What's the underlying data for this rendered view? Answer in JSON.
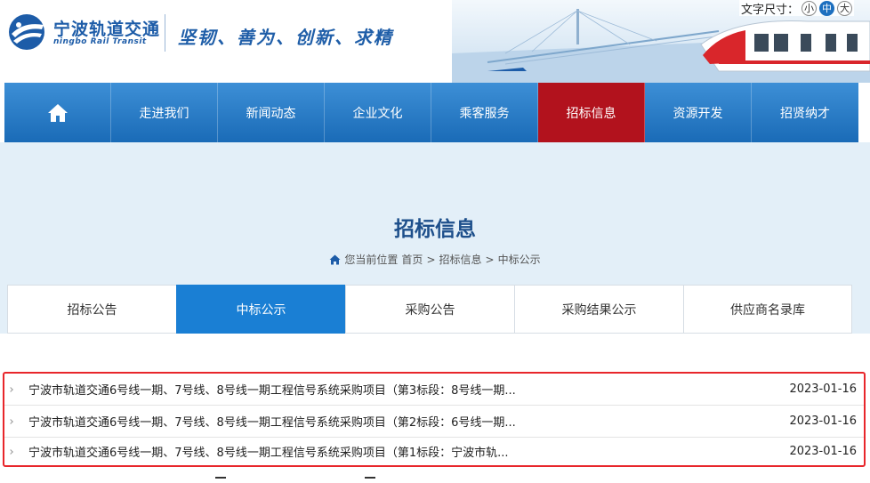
{
  "header": {
    "logo_cn": "宁波轨道交通",
    "logo_en": "ningbo Rail Transit",
    "slogan": "坚韧、善为、创新、求精",
    "fontsize_label": "文字尺寸：",
    "fontsize_options": [
      "小",
      "中",
      "大"
    ],
    "fontsize_selected": "中"
  },
  "nav": {
    "items": [
      {
        "label": "",
        "icon": "home-icon"
      },
      {
        "label": "走进我们"
      },
      {
        "label": "新闻动态"
      },
      {
        "label": "企业文化"
      },
      {
        "label": "乘客服务"
      },
      {
        "label": "招标信息"
      },
      {
        "label": "资源开发"
      },
      {
        "label": "招贤纳才"
      }
    ],
    "active_index": 5,
    "active_color": "#b2121d"
  },
  "hero": {
    "title": "招标信息",
    "breadcrumb_prefix": "您当前位置",
    "breadcrumb": [
      "首页",
      "招标信息",
      "中标公示"
    ],
    "separator": ">"
  },
  "tabs": {
    "items": [
      "招标公告",
      "中标公示",
      "采购公告",
      "采购结果公示",
      "供应商名录库"
    ],
    "active_index": 1
  },
  "list": {
    "items": [
      {
        "title": "宁波市轨道交通6号线一期、7号线、8号线一期工程信号系统采购项目（第3标段：8号线一期...",
        "date": "2023-01-16"
      },
      {
        "title": "宁波市轨道交通6号线一期、7号线、8号线一期工程信号系统采购项目（第2标段：6号线一期...",
        "date": "2023-01-16"
      },
      {
        "title": "宁波市轨道交通6号线一期、7号线、8号线一期工程信号系统采购项目（第1标段：宁波市轨...",
        "date": "2023-01-16"
      }
    ],
    "highlight_color": "#e8262b"
  },
  "colors": {
    "brand_blue": "#1d5ca8",
    "nav_blue": "#2a7cc7",
    "tab_active": "#1a7fd4",
    "hero_bg": "#e3eff8"
  }
}
